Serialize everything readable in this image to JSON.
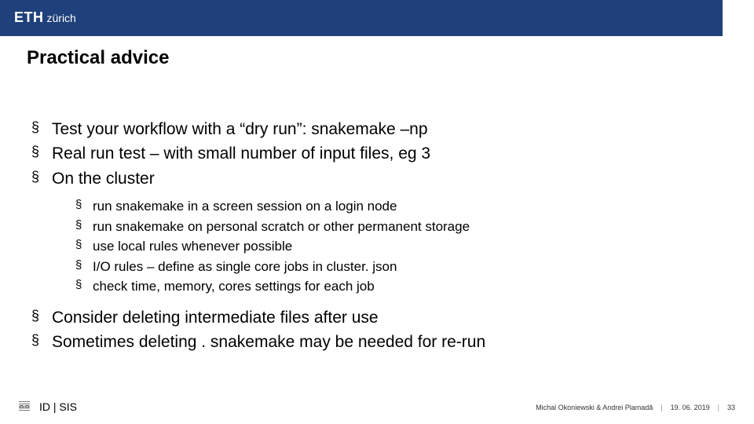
{
  "header": {
    "logo_bold": "ETH",
    "logo_light": "zürich"
  },
  "title": "Practical advice",
  "bullets": {
    "b0": "Test your workflow with a “dry run”: snakemake –np",
    "b1": "Real run test – with small number of input files, eg 3",
    "b2": "On the cluster",
    "sub": {
      "s0": "run snakemake in a screen session on a login node",
      "s1": "run snakemake on personal scratch or other permanent storage",
      "s2": "use local rules whenever possible",
      "s3": "I/O rules – define as single core jobs in cluster. json",
      "s4": "check time, memory, cores settings for each job"
    },
    "b3": "Consider deleting intermediate files after use",
    "b4": "Sometimes deleting . snakemake may be needed for re-run"
  },
  "footer": {
    "dept": "ID | SIS",
    "authors": "Michal Okoniewski & Andrei Plamadă",
    "date": "19. 06. 2019",
    "page": "33"
  }
}
